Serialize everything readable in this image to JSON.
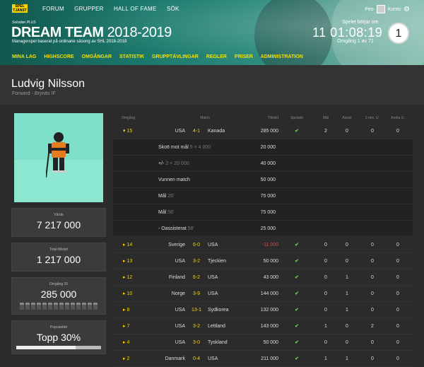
{
  "topnav": {
    "logo": "SPEL TJÄNST",
    "items": [
      "FORUM",
      "GRUPPER",
      "HALL OF FAME",
      "SÖK"
    ]
  },
  "user": {
    "name": "Peo",
    "account": "Konto"
  },
  "header": {
    "sponsor": "Solsidan PLUS",
    "title": "DREAM TEAM",
    "season": "2018-2019",
    "tagline": "Managerspel baserat på ordinarie säsong av SHL 2018-2019",
    "countdown_label": "Spelet börjar om",
    "countdown": "11 01:08:19",
    "round_label": "Omgång 1 av 71",
    "round_number": "1"
  },
  "subnav": [
    "MINA LAG",
    "HIGHSCORE",
    "OMGÅNGAR",
    "STATISTIK",
    "GRUPPTÄVLINGAR",
    "REGLER",
    "PRISER",
    "ADMINISTRATION"
  ],
  "player": {
    "name": "Ludvig Nilsson",
    "position": "Forward - Brynäs IF"
  },
  "stats": {
    "value_label": "Värde",
    "value": "7 217 000",
    "total_label": "Total tillväxt",
    "total": "1 217 000",
    "round_label": "Omgång 15",
    "round": "285 000",
    "popularity_label": "Popularitet",
    "popularity": "Topp 30%",
    "popularity_fraction": 0.7
  },
  "table": {
    "headers": [
      "Omgång",
      "Match",
      "Tillväxt",
      "Spelade",
      "Mål",
      "Assist",
      "2 min. U.",
      "Andra U."
    ],
    "expanded": {
      "round": "15",
      "home": "USA",
      "score": "4-1",
      "away": "Kanada",
      "points": "285 000",
      "played": "✔",
      "goals": "2",
      "assists": "0",
      "pim": "0",
      "other": "0"
    },
    "details": [
      {
        "desc": "Skott mot mål",
        "extra": "5 × 4 000",
        "points": "20 000"
      },
      {
        "desc": "+/-",
        "extra": "2 × 20 000",
        "points": "40 000"
      },
      {
        "desc": "Vunnen match",
        "extra": "",
        "points": "50 000"
      },
      {
        "desc": "Mål",
        "extra": "26'",
        "points": "75 000"
      },
      {
        "desc": "Mål",
        "extra": "58'",
        "points": "75 000"
      },
      {
        "desc": "- Oassisterat",
        "extra": "58'",
        "points": "25 000"
      }
    ],
    "rows": [
      {
        "round": "14",
        "home": "Sverige",
        "score": "6-0",
        "away": "USA",
        "points": "-11 000",
        "played": "✔",
        "goals": "0",
        "assists": "0",
        "pim": "0",
        "other": "0"
      },
      {
        "round": "13",
        "home": "USA",
        "score": "3-2",
        "away": "Tjeckien",
        "points": "50 000",
        "played": "✔",
        "goals": "0",
        "assists": "0",
        "pim": "0",
        "other": "0"
      },
      {
        "round": "12",
        "home": "Finland",
        "score": "6-2",
        "away": "USA",
        "points": "43 000",
        "played": "✔",
        "goals": "0",
        "assists": "1",
        "pim": "0",
        "other": "0"
      },
      {
        "round": "10",
        "home": "Norge",
        "score": "3-9",
        "away": "USA",
        "points": "144 000",
        "played": "✔",
        "goals": "0",
        "assists": "1",
        "pim": "0",
        "other": "0"
      },
      {
        "round": "8",
        "home": "USA",
        "score": "13-1",
        "away": "Sydkorea",
        "points": "132 000",
        "played": "✔",
        "goals": "0",
        "assists": "1",
        "pim": "0",
        "other": "0"
      },
      {
        "round": "7",
        "home": "USA",
        "score": "3-2",
        "away": "Lettland",
        "points": "143 000",
        "played": "✔",
        "goals": "1",
        "assists": "0",
        "pim": "2",
        "other": "0"
      },
      {
        "round": "4",
        "home": "USA",
        "score": "3-0",
        "away": "Tyskland",
        "points": "50 000",
        "played": "✔",
        "goals": "0",
        "assists": "0",
        "pim": "0",
        "other": "0"
      },
      {
        "round": "2",
        "home": "Danmark",
        "score": "0-4",
        "away": "USA",
        "points": "211 000",
        "played": "✔",
        "goals": "1",
        "assists": "1",
        "pim": "0",
        "other": "0"
      }
    ]
  }
}
